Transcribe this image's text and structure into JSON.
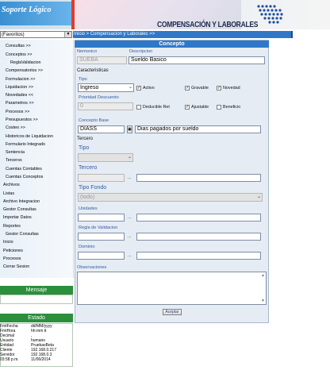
{
  "header": {
    "logo": "Soporte Lógico",
    "brand": "COMPENSACIÓN Y LABORALES"
  },
  "topbar": {
    "select_value": "(Favoritos)",
    "breadcrumb": "Inicio > Compensacion y Laborales >>"
  },
  "sidebar": {
    "items": [
      "Consultas >>",
      "Conceptos >>",
      "ReglaValidacion",
      "Compensatorios >>",
      "Formulacion >>",
      "Liquidacion >>",
      "Novedades <<",
      "Parametros >>",
      "Procesos >>",
      "Presupuestos >>",
      "Costeo >>",
      "Historicos de Liquidacion",
      "Formulario Integrado",
      "Sentencia",
      "Terceros",
      "Cuentas Contables",
      "Cuentas Conceptos",
      "Archivos",
      "Listas",
      "Archivo Integracion",
      "Gestor Consultas",
      "Importar Datos",
      "Reportes",
      "Gestor Consultas",
      "Inicio",
      "Peticiones",
      "Procesos",
      "Cerrar Sesion"
    ]
  },
  "mensaje": {
    "title": "Mensaje"
  },
  "estado": {
    "title": "Estado",
    "rows": [
      {
        "k": "FmtFecha",
        "v": "dd/MM/yyyy"
      },
      {
        "k": "FmtHora",
        "v": "hh:mm tt"
      },
      {
        "k": "Decimal",
        "v": ","
      },
      {
        "k": "Usuario",
        "v": "humano"
      },
      {
        "k": "Entidad",
        "v": "PruebasBeta"
      },
      {
        "k": "Cliente",
        "v": "192.168.0.217"
      },
      {
        "k": "Servidor",
        "v": "192.168.0.3"
      },
      {
        "k": "03:58 p.m.",
        "v": "11/06/2014"
      }
    ]
  },
  "form": {
    "title": "Concepto",
    "nemonico_label": "Nemonico",
    "nemonico_value": "SUEBA",
    "descripcion_label": "Descripcion",
    "descripcion_value": "Sueldo Basico",
    "caracteristicas_label": "Caracteristicas",
    "tipo_label": "Tipo",
    "tipo_value": "Ingreso",
    "activo_label": "Activo",
    "gravable_label": "Gravable",
    "novedad_label": "Novedad",
    "prioridad_label": "Prioridad Descuento",
    "prioridad_value": "0",
    "deducible_label": "Deducible Ret",
    "ajustable_label": "Ajustable",
    "beneficio_label": "Beneficio",
    "concepto_base_label": "Concepto Base",
    "concepto_base_code": "DIASS",
    "concepto_base_desc": "Dias pagados por sueldo",
    "tercero_section_label": "Tercero",
    "tercero_tipo_label": "Tipo",
    "tercero_label": "Tercero",
    "tipo_fondo_label": "Tipo Fondo",
    "tipo_fondo_value": "(todo)",
    "unidades_label": "Unidades",
    "regla_label": "Regla de Validacion",
    "dominio_label": "Dominio",
    "observaciones_label": "Observaciones",
    "accept_label": "Aceptar",
    "dots": "..."
  },
  "icons": {
    "select_arrow": "chevron-down-icon",
    "lookup": "ellipsis-icon",
    "check": "checkmark-icon"
  }
}
